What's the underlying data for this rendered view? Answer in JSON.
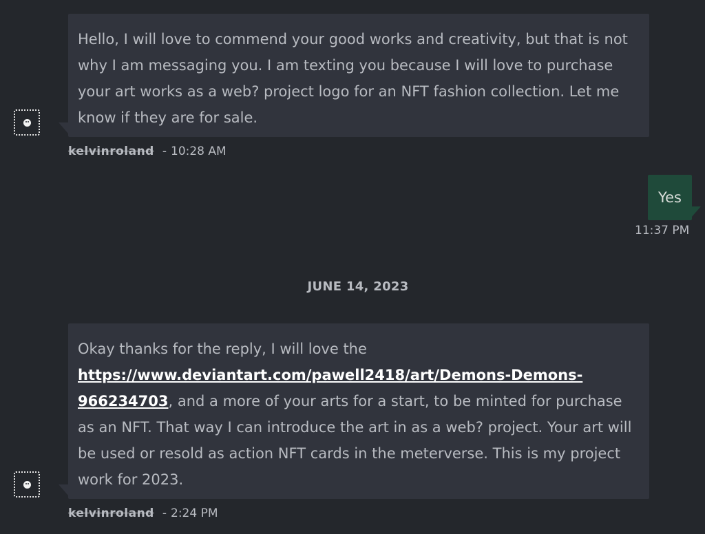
{
  "messages": [
    {
      "text": "Hello, I will love to commend your good works and creativity, but that is not why I am messaging you. I am texting you because I will love to purchase your art works as a web? project logo for an NFT fashion collection. Let me know if they are for sale.",
      "username": "kelvinroland",
      "separator": "-",
      "time": "10:28 AM"
    },
    {
      "text": "Yes",
      "time": "11:37 PM"
    },
    {
      "date_divider": "JUNE 14, 2023"
    },
    {
      "text_before_link": "Okay thanks for the reply, I will love the ",
      "link": "https://www.deviantart.com/pawell2418/art/Demons-Demons-966234703",
      "text_after_link": ", and a more of your arts for a start, to be minted for purchase as an NFT. That way I can introduce the art in as a web? project. Your art will be used or resold as action NFT cards in the meterverse. This is my project work for 2023.",
      "username": "kelvinroland",
      "separator": "-",
      "time": "2:24 PM"
    }
  ],
  "icons": {
    "avatar": "user-avatar-icon"
  },
  "colors": {
    "background": "#24272c",
    "received_bubble": "#31343d",
    "sent_bubble": "#1f4a3a",
    "text": "#b8bbc1",
    "link": "#ffffff"
  }
}
